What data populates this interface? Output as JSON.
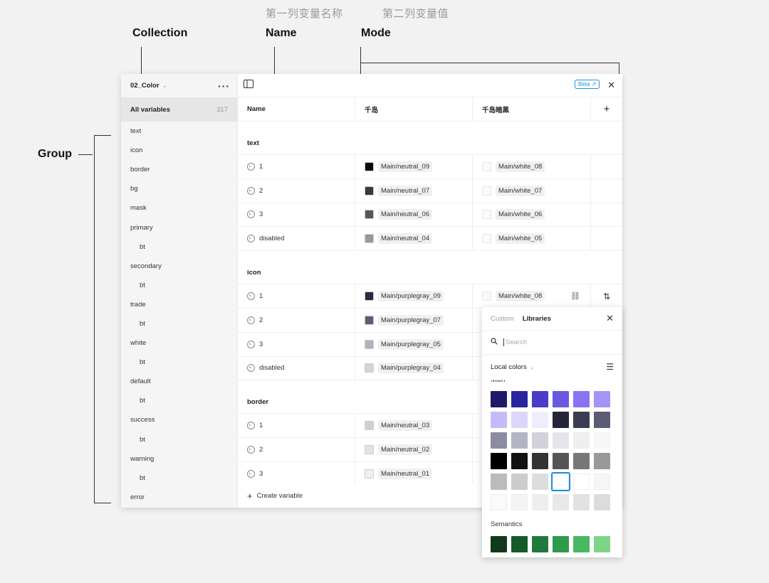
{
  "annotations": {
    "col1_cn": "第一列变量名称",
    "col2_cn": "第二列变量值",
    "collection": "Collection",
    "name": "Name",
    "mode": "Mode",
    "group": "Group"
  },
  "sidebar": {
    "collection_name": "02_Color",
    "all_label": "All variables",
    "all_count": "317",
    "groups": [
      "text",
      "icon",
      "border",
      "bg",
      "mask",
      "primary",
      "bt",
      "secondary",
      "bt",
      "trade",
      "bt",
      "white",
      "bt",
      "default",
      "bt",
      "success",
      "bt",
      "warning",
      "bt",
      "error"
    ]
  },
  "topbar": {
    "beta": "Beta"
  },
  "table": {
    "headers": [
      "Name",
      "千岛",
      "千岛暗黑"
    ],
    "sections": [
      {
        "title": "text",
        "rows": [
          {
            "name": "1",
            "v1": "Main/neutral_09",
            "v2": "Main/white_08"
          },
          {
            "name": "2",
            "v1": "Main/neutral_07",
            "v2": "Main/white_07"
          },
          {
            "name": "3",
            "v1": "Main/neutral_06",
            "v2": "Main/white_06"
          },
          {
            "name": "disabled",
            "v1": "Main/neutral_04",
            "v2": "Main/white_05"
          }
        ]
      },
      {
        "title": "icon",
        "rows": [
          {
            "name": "1",
            "v1": "Main/purplegray_09",
            "v2": "Main/white_08"
          },
          {
            "name": "2",
            "v1": "Main/purplegray_07",
            "v2": ""
          },
          {
            "name": "3",
            "v1": "Main/purplegray_05",
            "v2": ""
          },
          {
            "name": "disabled",
            "v1": "Main/purplegray_04",
            "v2": ""
          }
        ]
      },
      {
        "title": "border",
        "rows": [
          {
            "name": "1",
            "v1": "Main/neutral_03",
            "v2": ""
          },
          {
            "name": "2",
            "v1": "Main/neutral_02",
            "v2": ""
          },
          {
            "name": "3",
            "v1": "Main/neutral_01",
            "v2": ""
          }
        ]
      }
    ],
    "create_label": "Create variable"
  },
  "swatch_colors": {
    "text": [
      "#0a0a0a",
      "#3a3a3a",
      "#555555",
      "#999999"
    ],
    "icon": [
      "#2a2a40",
      "#5c5c78",
      "#b2b2c0",
      "#d4d4da"
    ],
    "border": [
      "#cfcfcf",
      "#e2e2e2",
      "#efefef"
    ]
  },
  "popup": {
    "tab_custom": "Custom",
    "tab_libraries": "Libraries",
    "search_placeholder": "Search",
    "local_colors": "Local colors",
    "main_label": "Main",
    "semantics_label": "Semantics",
    "main_colors": [
      "#1e1a6a",
      "#2b24a0",
      "#4a3bc8",
      "#6a58e0",
      "#8a72f4",
      "#a494f6",
      "#c4bcf8",
      "#dcd6fb",
      "#efedfd",
      "#26263a",
      "#3c3c52",
      "#5c5c74",
      "#8c8ca0",
      "#b4b4c4",
      "#d2d2da",
      "#e4e4ea",
      "#efeff2",
      "#f6f6f8",
      "#000000",
      "#111111",
      "#333333",
      "#555555",
      "#777777",
      "#999999",
      "#bbbbbb",
      "#cccccc",
      "#dddddd",
      "#ffffff",
      "#ffffff",
      "#f6f6f6",
      "#fafafa",
      "#f4f4f4",
      "#eeeeee",
      "#e8e8e8",
      "#e2e2e2",
      "#dcdcdc"
    ],
    "semantic_colors": [
      "#0f3a1c",
      "#145a28",
      "#1f7a3c",
      "#2e9a4c",
      "#4ab862",
      "#7ed488"
    ]
  }
}
